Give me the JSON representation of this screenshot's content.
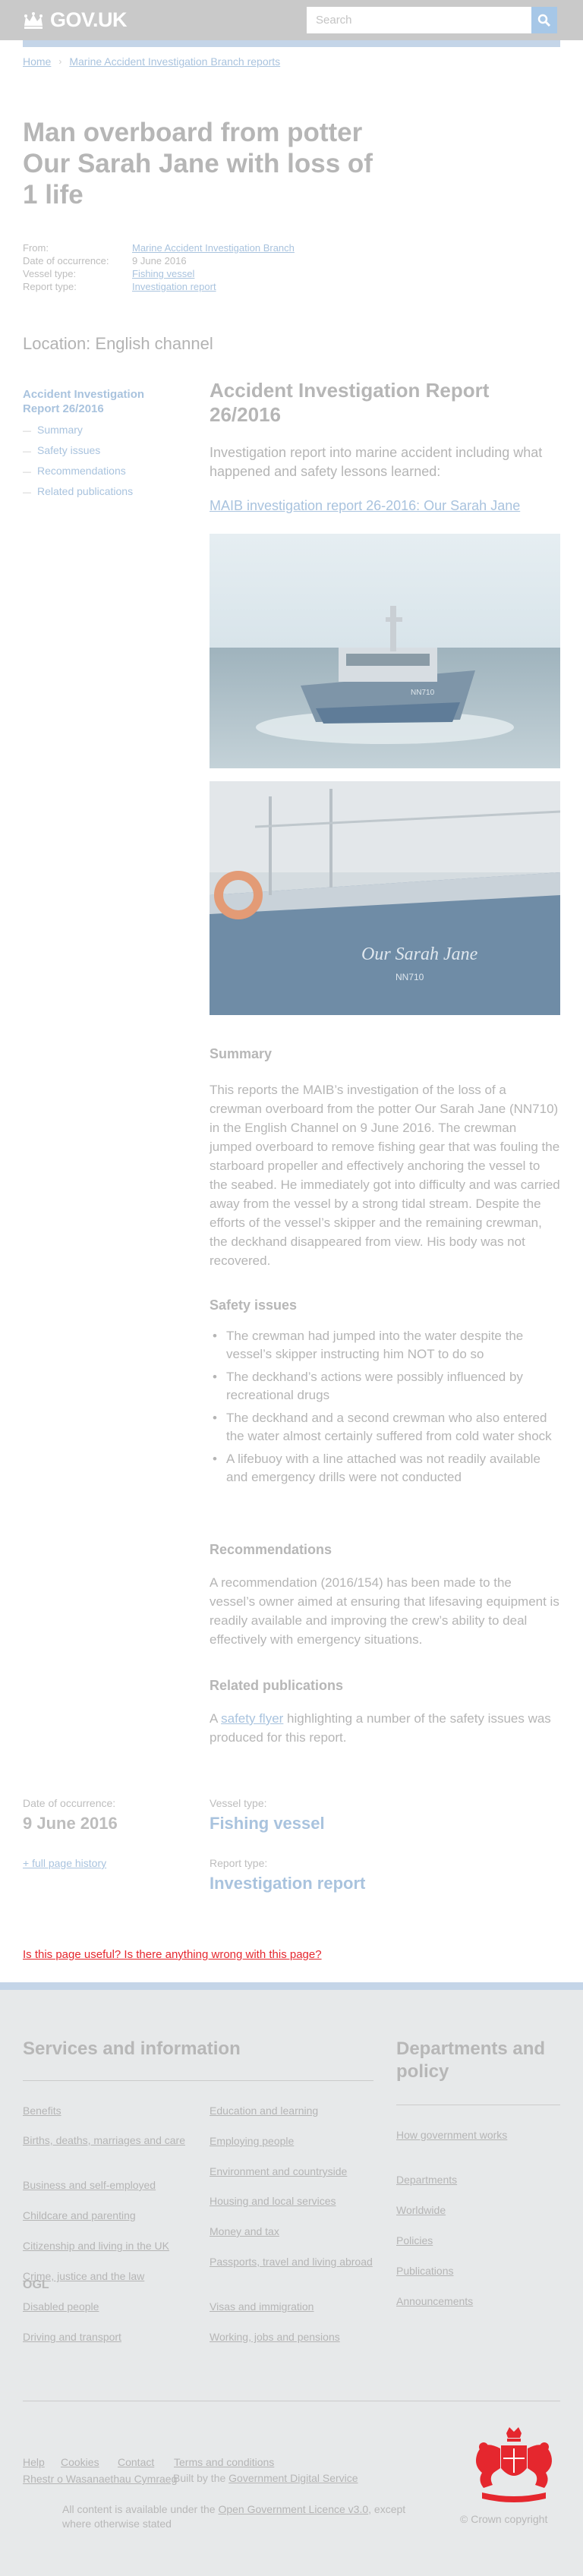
{
  "header": {
    "logo_text": "GOV.UK",
    "search_placeholder": "Search",
    "search_icon": "search-icon"
  },
  "breadcrumb": [
    "Home",
    "Marine Accident Investigation Branch reports"
  ],
  "title": "Man overboard from potter Our Sarah Jane with loss of 1 life",
  "metadata": {
    "from_label": "From:",
    "from_value": "Marine Accident Investigation Branch",
    "date_label": "Date of occurrence:",
    "date_value": "9 June 2016",
    "vessel_label": "Vessel type:",
    "vessel_value": "Fishing vessel",
    "report_label": "Report type:",
    "report_value": "Investigation report"
  },
  "location": "Location: English channel",
  "contents": {
    "title": "Accident Investigation Report 26/2016",
    "items": [
      "Summary",
      "Safety issues",
      "Recommendations",
      "Related publications"
    ]
  },
  "main": {
    "heading": "Accident Investigation Report 26/2016",
    "intro": "Investigation report into marine accident including what happened and safety lessons learned:",
    "doc_link": "MAIB investigation report 26-2016: Our Sarah Jane"
  },
  "images": {
    "vessel_name": "Our Sarah Jane",
    "vessel_reg": "NN710"
  },
  "summary": {
    "heading": "Summary",
    "text": "This reports the MAIB’s investigation of the loss of a crewman overboard from the potter Our Sarah Jane (NN710) in the English Channel on 9 June 2016. The crewman jumped overboard to remove fishing gear that was fouling the starboard propeller and effectively anchoring the vessel to the seabed. He immediately got into difficulty and was carried away from the vessel by a strong tidal stream. Despite the efforts of the vessel’s skipper and the remaining crewman, the deckhand disappeared from view. His body was not recovered."
  },
  "safety": {
    "heading": "Safety issues",
    "items": [
      "The crewman had jumped into the water despite the vessel’s skipper instructing him NOT to do so",
      "The deckhand’s actions were possibly influenced by recreational drugs",
      "The deckhand and a second crewman who also entered the water almost certainly suffered from cold water shock",
      "A lifebuoy with a line attached was not readily available and emergency drills were not conducted"
    ]
  },
  "recommendations": {
    "heading": "Recommendations",
    "text": "A recommendation (2016/154) has been made to the vessel’s owner aimed at ensuring that lifesaving equipment is readily available and improving the crew’s ability to deal effectively with emergency situations."
  },
  "related": {
    "heading": "Related publications",
    "prefix": "A ",
    "link": "safety flyer",
    "suffix": " highlighting a number of the safety issues was produced for this report."
  },
  "bottom_meta": {
    "date_label": "Date of occurrence:",
    "date_value": "9 June 2016",
    "vessel_label": "Vessel type:",
    "vessel_value": "Fishing vessel",
    "report_label": "Report type:",
    "report_value": "Investigation report",
    "history_link": "+ full page history"
  },
  "report_problem": "Is this page useful? Is there anything wrong with this page?",
  "footer": {
    "services_heading": "Services and information",
    "departments_heading": "Departments and policy",
    "services_col1": [
      "Benefits",
      "Births, deaths, marriages and care",
      "Business and self-employed",
      "Childcare and parenting",
      "Citizenship and living in the UK",
      "Crime, justice and the law",
      "Disabled people",
      "Driving and transport"
    ],
    "services_col2": [
      "Education and learning",
      "Employing people",
      "Environment and countryside",
      "Housing and local services",
      "Money and tax",
      "Passports, travel and living abroad",
      "Visas and immigration",
      "Working, jobs and pensions"
    ],
    "departments": [
      "How government works",
      "Departments",
      "Worldwide",
      "Policies",
      "Publications",
      "Announcements"
    ],
    "meta_links": [
      "Help",
      "Cookies",
      "Contact",
      "Terms and conditions"
    ],
    "welsh_link": "Rhestr o Wasanaethau Cymraeg",
    "built_by_prefix": "Built by the ",
    "built_by_link": "Government Digital Service",
    "licence_prefix": "All content is available under the ",
    "licence_link": "Open Government Licence v3.0",
    "licence_suffix": ", except where otherwise stated",
    "copyright": "© Crown copyright"
  },
  "colors": {
    "header_bg": "#c9c9c9",
    "link": "#a9c3de",
    "accent_blue": "#c4d5e8",
    "crest_red": "#e5272e",
    "footer_bg": "#e7e9ea"
  }
}
